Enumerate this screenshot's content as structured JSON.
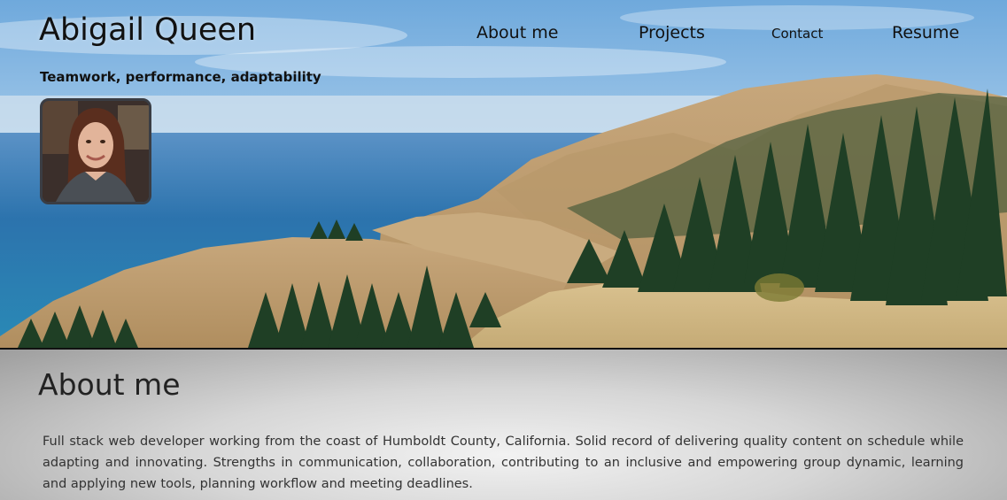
{
  "header": {
    "name": "Abigail Queen",
    "tagline": "Teamwork, performance, adaptability"
  },
  "nav": {
    "about": "About me",
    "projects": "Projects",
    "contact": "Contact",
    "resume": "Resume"
  },
  "about": {
    "heading": "About me",
    "body": "Full stack web developer working from the coast of Humboldt County, California. Solid record of delivering quality content on schedule while adapting and innovating. Strengths in communication, collaboration, contributing to an inclusive and empowering group dynamic, learning and applying new tools, planning workflow and meeting deadlines."
  },
  "colors": {
    "sky": "#8fc1ea",
    "ocean": "#2c7bb3",
    "hills": "#c8a878",
    "trees": "#1f4a2a",
    "section_bg": "#d6d6d6"
  }
}
